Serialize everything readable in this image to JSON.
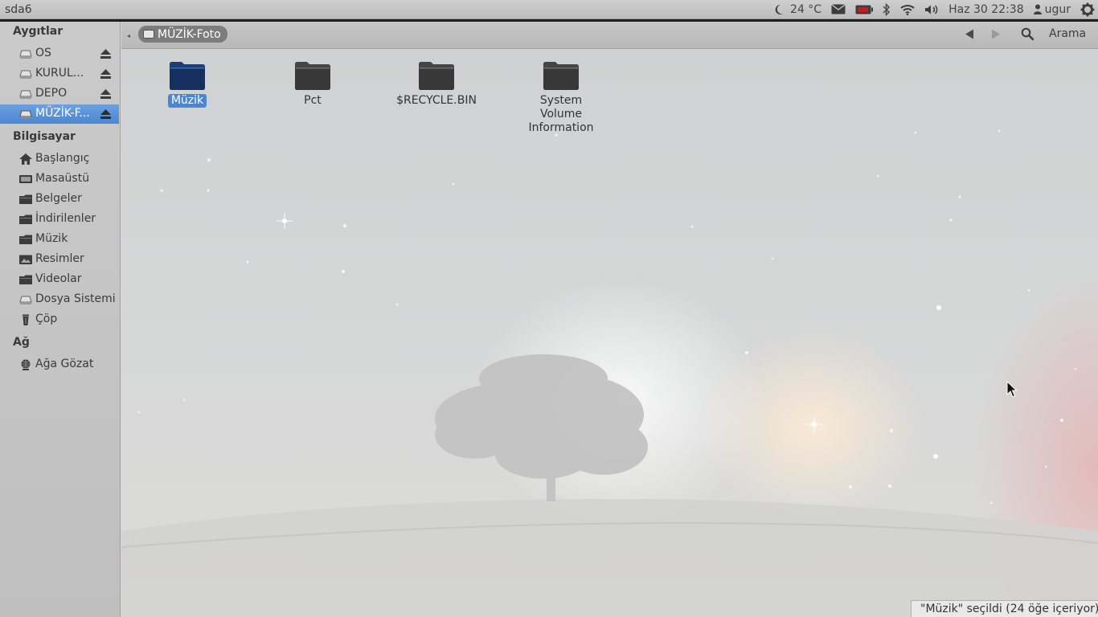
{
  "top_panel": {
    "window_title": "sda6",
    "weather": "24 °C",
    "datetime": "Haz 30 22:38",
    "user": "ugur",
    "icons": [
      "moon-icon",
      "mail-icon",
      "battery-icon",
      "bluetooth-icon",
      "wifi-icon",
      "volume-icon",
      "user-icon",
      "gear-icon"
    ]
  },
  "sidebar": {
    "devices_heading": "Aygıtlar",
    "devices": [
      {
        "label": "OS"
      },
      {
        "label": "KURUL..."
      },
      {
        "label": "DEPO"
      },
      {
        "label": "MÜZİK-F..."
      }
    ],
    "computer_heading": "Bilgisayar",
    "places": [
      {
        "label": "Başlangıç",
        "icon": "home-icon"
      },
      {
        "label": "Masaüstü",
        "icon": "desktop-icon"
      },
      {
        "label": "Belgeler",
        "icon": "folder-icon"
      },
      {
        "label": "İndirilenler",
        "icon": "folder-icon"
      },
      {
        "label": "Müzik",
        "icon": "folder-icon"
      },
      {
        "label": "Resimler",
        "icon": "pictures-icon"
      },
      {
        "label": "Videolar",
        "icon": "folder-icon"
      },
      {
        "label": "Dosya Sistemi",
        "icon": "drive-icon"
      },
      {
        "label": "Çöp",
        "icon": "trash-icon"
      }
    ],
    "network_heading": "Ağ",
    "network": [
      {
        "label": "Ağa Gözat",
        "icon": "network-icon"
      }
    ]
  },
  "toolbar": {
    "path": "MÜZİK-Foto",
    "search_label": "Arama"
  },
  "files": [
    {
      "name": "Müzik",
      "selected": true
    },
    {
      "name": "Pct",
      "selected": false
    },
    {
      "name": "$RECYCLE.BIN",
      "selected": false
    },
    {
      "name": "System Volume Information",
      "selected": false
    }
  ],
  "status": "\"Müzik\" seçildi (24 öğe içeriyor)",
  "colors": {
    "selection": "#4a86d3",
    "panel": "#c4c4c4",
    "folder": "#3a3a3a",
    "folder_selected": "#1e3e78"
  }
}
